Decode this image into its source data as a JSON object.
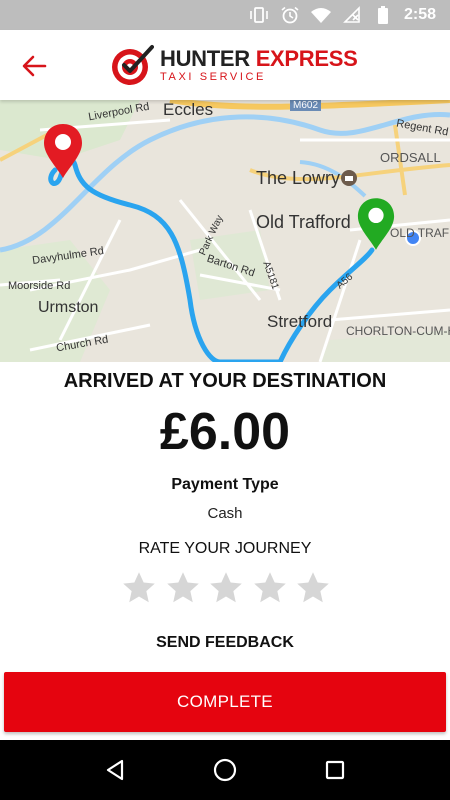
{
  "status_bar": {
    "time": "2:58",
    "icons": [
      "vibrate-icon",
      "alarm-icon",
      "wifi-icon",
      "no-sim-icon",
      "battery-icon"
    ]
  },
  "header": {
    "logo_word1": "HUNTER",
    "logo_word2": "EXPRESS",
    "logo_subtitle": "TAXI SERVICE",
    "back_icon": "arrow-left-icon",
    "brand_color": "#d7141a"
  },
  "map": {
    "labels": {
      "eccles": "Eccles",
      "liverpool_rd": "Liverpool Rd",
      "m602": "M602",
      "regent_rd": "Regent Rd",
      "ordsall": "ORDSALL",
      "the_lowry": "The Lowry",
      "old_trafford": "Old Trafford",
      "old_traff": "OLD TRAFF",
      "park_way": "Park Way",
      "davyhulme_rd": "Davyhulme Rd",
      "barton_rd": "Barton Rd",
      "a5181": "A5181",
      "moorside_rd": "Moorside Rd",
      "urmston": "Urmston",
      "stretford": "Stretford",
      "chorlton": "CHORLTON-CUM-HA",
      "church_rd": "Church Rd",
      "a56": "A56"
    },
    "route_color": "#2aa4ef",
    "start_pin_color": "#e31b23",
    "end_pin_color": "#22aa22"
  },
  "trip": {
    "status_title": "ARRIVED AT YOUR DESTINATION",
    "fare": "£6.00",
    "payment_label": "Payment Type",
    "payment_value": "Cash",
    "rate_label": "RATE YOUR JOURNEY",
    "rating": 0,
    "max_rating": 5,
    "feedback_label": "SEND FEEDBACK"
  },
  "actions": {
    "complete_label": "COMPLETE",
    "complete_color": "#e5040f"
  },
  "nav_bar": {
    "icons": [
      "back-triangle-icon",
      "home-circle-icon",
      "recents-square-icon"
    ]
  }
}
